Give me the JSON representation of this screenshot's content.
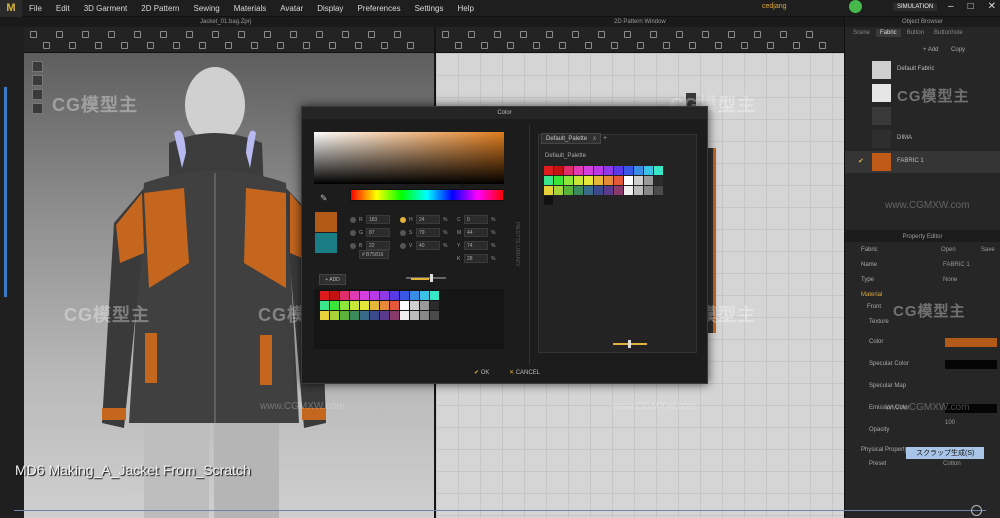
{
  "menubar": {
    "items": [
      "File",
      "Edit",
      "3D Garment",
      "2D Pattern",
      "Sewing",
      "Materials",
      "Avatar",
      "Display",
      "Preferences",
      "Settings",
      "Help"
    ],
    "user": "cedjang",
    "simulation_label": "SIMULATION"
  },
  "window_controls": [
    "–",
    "□",
    "✕"
  ],
  "tabs": {
    "file_tab": "Jacket_01.bag.Zprj",
    "pattern_window": "2D Pattern Window"
  },
  "object_browser": {
    "title": "Object Browser",
    "tabs": [
      "Scene",
      "Fabric",
      "Button",
      "Buttonhole"
    ],
    "add_label": "+ Add",
    "copy_label": "Copy",
    "fabrics": [
      {
        "name": "Default Fabric",
        "color": "#cfcfcf"
      },
      {
        "name": "",
        "color": "#e6e6e6"
      },
      {
        "name": "",
        "color": "#3a3a3a"
      },
      {
        "name": "DIMA",
        "color": "#2e2e2e"
      },
      {
        "name": "FABRIC 1",
        "color": "#c05a18"
      }
    ]
  },
  "property_editor": {
    "title": "Property Editor",
    "fabric_label": "Fabric",
    "open_label": "Open",
    "save_label": "Save",
    "name_label": "Name",
    "name_value": "FABRIC 1",
    "type_label": "Type",
    "type_value": "None",
    "material_label": "Material",
    "front_label": "Front",
    "texture_label": "Texture",
    "color_label": "Color",
    "color_value": "#b45a18",
    "specular_label": "Specular Color",
    "specular_map_label": "Specular Map",
    "emission_label": "Emission Color",
    "opacity_label": "Opacity",
    "opacity_value": "100",
    "physical_label": "Physical Property",
    "preset_label": "Preset",
    "preset_value": "Cotton"
  },
  "color_dialog": {
    "title": "Color",
    "new_color": "#b45a18",
    "old_color": "#1a7d86",
    "fields": {
      "R": "183",
      "G": "87",
      "B": "22",
      "H": "24",
      "S": "79",
      "V": "40",
      "C": "0",
      "M": "44",
      "Y": "74",
      "K": "28"
    },
    "hex_value": "# B75816",
    "percent": "%",
    "add_label": "+ ADD",
    "vertical_label": "PALETTE LIBRARY",
    "palette_tab": "Default_Palette",
    "palette_tab_close": "x",
    "palette_add": "+",
    "palette_name": "Default_Palette",
    "ok_label": "OK",
    "cancel_label": "CANCEL",
    "left_palette": [
      [
        "#e01b1b",
        "#c41212",
        "#e02e6a",
        "#e23ab2",
        "#d43fe0",
        "#b93ae6",
        "#8f3ae6",
        "#5a3ae6",
        "#3a58e6",
        "#3a8de6",
        "#3ac3e6",
        "#3ae6c8"
      ],
      [
        "#3ae68a",
        "#3ae63a",
        "#8de63a",
        "#c8e63a",
        "#e6e63a",
        "#e6b83a",
        "#e68a3a",
        "#e6583a",
        "#ffffff",
        "#cfcfcf",
        "#9a9a9a",
        "#2b2b2b"
      ],
      [
        "#e6d13a",
        "#a8d43a",
        "#5ab23a",
        "#3a8a5a",
        "#3a6a8a",
        "#3a4a8a",
        "#5a3a8a",
        "#8a3a6a",
        "#eeeeee",
        "#bbbbbb",
        "#888888",
        "#4a4a4a"
      ]
    ],
    "right_palette": [
      [
        "#e01b1b",
        "#c41212",
        "#e02e6a",
        "#e23ab2",
        "#d43fe0",
        "#b93ae6",
        "#8f3ae6",
        "#5a3ae6",
        "#3a58e6",
        "#3a8de6",
        "#3ac3e6",
        "#3ae6c8"
      ],
      [
        "#3ae68a",
        "#3ae63a",
        "#8de63a",
        "#c8e63a",
        "#e6e63a",
        "#e6b83a",
        "#e68a3a",
        "#e6583a",
        "#ffffff",
        "#cfcfcf",
        "#9a9a9a",
        "#2b2b2b"
      ],
      [
        "#e6d13a",
        "#a8d43a",
        "#5ab23a",
        "#3a8a5a",
        "#3a6a8a",
        "#3a4a8a",
        "#5a3a8a",
        "#8a3a6a",
        "#eeeeee",
        "#bbbbbb",
        "#888888",
        "#4a4a4a"
      ],
      [
        "#111111"
      ]
    ]
  },
  "watermarks": {
    "cg": "CG模型主",
    "url": "www.CGMXW.com"
  },
  "subtitle": "MD6  Making_A_Jacket From_Scratch",
  "jp_label": "スクラップ生成(S)",
  "progress": 0.99
}
